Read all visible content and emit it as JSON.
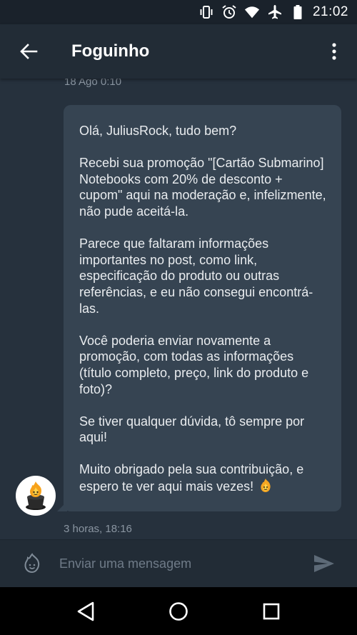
{
  "status_bar": {
    "time": "21:02",
    "icons": [
      "vibrate-icon",
      "alarm-icon",
      "wifi-icon",
      "airplane-icon",
      "battery-icon"
    ]
  },
  "app_bar": {
    "title": "Foguinho",
    "back_icon": "arrow-back-icon",
    "menu_icon": "more-vert-icon"
  },
  "chat": {
    "previous_timestamp": "18 Ago 0:10",
    "message": {
      "paragraphs": [
        "Olá, JuliusRock, tudo bem?",
        "Recebi sua promoção  \"[Cartão Submarino] Notebooks com 20% de desconto + cupom\" aqui na moderação e, infelizmente, não pude aceitá-la.",
        "Parece que faltaram informações importantes no post, como link, especificação do produto ou outras referências, e eu não consegui encontrá-las.",
        "Você poderia enviar novamente a promoção, com todas as informações (título completo, preço, link do produto e foto)?",
        "Se tiver qualquer dúvida, tô sempre por aqui!",
        "Muito obrigado pela sua contribuição, e espero te ver aqui mais vezes!"
      ],
      "trailing_emoji": "fire-face-emoji",
      "timestamp": "3 horas, 18:16"
    },
    "avatar": "foguinho-mascot-avatar"
  },
  "input": {
    "placeholder": "Enviar uma mensagem",
    "value": "",
    "emoji_icon": "emoji-icon",
    "send_icon": "send-icon"
  },
  "nav_bar": {
    "icons": [
      "nav-back-icon",
      "nav-home-icon",
      "nav-recents-icon"
    ]
  },
  "colors": {
    "background": "#26313d",
    "app_bar": "#222c36",
    "bubble": "#364452",
    "timestamp": "#8a95a1",
    "placeholder": "#6f7b88"
  }
}
